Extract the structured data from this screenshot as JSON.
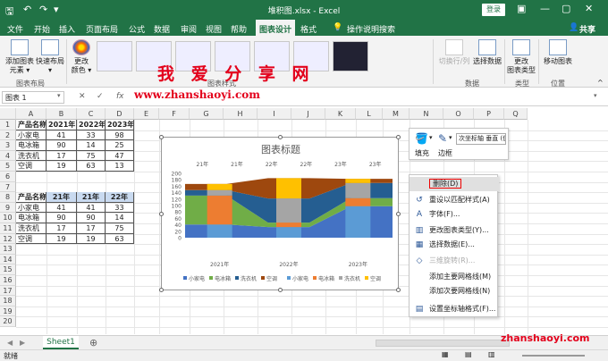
{
  "titlebar": {
    "title": "堆积图.xlsx - Excel",
    "login": "登录",
    "minimize": "—",
    "restore": "▢",
    "close": "✕"
  },
  "menu": {
    "tabs": [
      "文件",
      "开始",
      "插入",
      "页面布局",
      "公式",
      "数据",
      "审阅",
      "视图",
      "帮助",
      "图表设计",
      "格式"
    ],
    "active": "图表设计",
    "tellme": "操作说明搜索",
    "share": "共享"
  },
  "ribbon": {
    "add_element": "添加图表\n元素 ▾",
    "quick_layout": "快速布局\n▾",
    "change_colors": "更改\n颜色 ▾",
    "group_layout": "图表布局",
    "group_styles": "图表样式",
    "switch_row_col": "切换行/列",
    "select_data": "选择数据",
    "change_type": "更改\n图表类型",
    "move_chart": "移动图表",
    "group_data": "数据",
    "group_type": "类型",
    "group_location": "位置"
  },
  "watermark": {
    "line1": "我 爱 分 享 网",
    "line2": "www.zhanshaoyi.com",
    "footer": "zhanshaoyi.com"
  },
  "formula": {
    "namebox": "图表 1",
    "cancel": "✕",
    "enter": "✓",
    "fx": "fx"
  },
  "columns": [
    "A",
    "B",
    "C",
    "D",
    "E",
    "F",
    "G",
    "H",
    "I",
    "J",
    "K",
    "L",
    "M",
    "N",
    "O",
    "P",
    "Q"
  ],
  "rows": [
    "1",
    "2",
    "3",
    "4",
    "5",
    "6",
    "7",
    "8",
    "9",
    "10",
    "11",
    "12",
    "13",
    "14",
    "15",
    "16",
    "17",
    "18",
    "19",
    "20"
  ],
  "table1": {
    "header": [
      "产品名称",
      "2021年",
      "2022年",
      "2023年"
    ],
    "rows": [
      [
        "小家电",
        "41",
        "33",
        "98"
      ],
      [
        "电冰箱",
        "90",
        "14",
        "25"
      ],
      [
        "洗衣机",
        "17",
        "75",
        "47"
      ],
      [
        "空调",
        "19",
        "63",
        "13"
      ]
    ]
  },
  "table2": {
    "header": [
      "产品名称",
      "21年",
      "21年",
      "22年"
    ],
    "rows": [
      [
        "小家电",
        "41",
        "41",
        "33"
      ],
      [
        "电冰箱",
        "90",
        "90",
        "14"
      ],
      [
        "洗衣机",
        "17",
        "17",
        "75"
      ],
      [
        "空调",
        "19",
        "19",
        "63"
      ]
    ]
  },
  "chart_data": {
    "type": "area",
    "title": "图表标题",
    "top_axis_labels": [
      "21年",
      "21年",
      "22年",
      "22年",
      "23年",
      "23年"
    ],
    "categories": [
      "2021年",
      "2022年",
      "2023年"
    ],
    "ylim": [
      0,
      200
    ],
    "yticks": [
      "0",
      "20",
      "40",
      "60",
      "80",
      "100",
      "120",
      "140",
      "160",
      "180",
      "200"
    ],
    "bar_series": [
      {
        "name": "小家电",
        "values": [
          41,
          33,
          98
        ],
        "color": "#5b9bd5"
      },
      {
        "name": "电冰箱",
        "values": [
          90,
          14,
          25
        ],
        "color": "#ed7d31"
      },
      {
        "name": "洗衣机",
        "values": [
          17,
          75,
          47
        ],
        "color": "#a5a5a5"
      },
      {
        "name": "空调",
        "values": [
          19,
          63,
          13
        ],
        "color": "#ffc000"
      }
    ],
    "area_series": [
      {
        "name": "小家电",
        "values": [
          41,
          41,
          33,
          33,
          98,
          98
        ],
        "color": "#4472c4"
      },
      {
        "name": "电冰箱",
        "values": [
          90,
          90,
          14,
          14,
          25,
          25
        ],
        "color": "#70ad47"
      },
      {
        "name": "洗衣机",
        "values": [
          17,
          17,
          75,
          75,
          47,
          47
        ],
        "color": "#255e91"
      },
      {
        "name": "空调",
        "values": [
          19,
          19,
          63,
          63,
          13,
          13
        ],
        "color": "#9e480e"
      }
    ],
    "legend": [
      "小家电",
      "电冰箱",
      "洗衣机",
      "空调",
      "小家电",
      "电冰箱",
      "洗衣机",
      "空调"
    ],
    "legend_colors": [
      "#4472c4",
      "#70ad47",
      "#255e91",
      "#9e480e",
      "#5b9bd5",
      "#ed7d31",
      "#a5a5a5",
      "#ffc000"
    ],
    "legend_position": "bottom"
  },
  "minitoolbar": {
    "fill": "填充",
    "border": "边框",
    "dropdown": "次坐标轴 垂直 (值"
  },
  "context_menu": {
    "items": [
      {
        "label": "删除(D)",
        "icon": "",
        "disabled": false,
        "highlight": true
      },
      {
        "label": "重设以匹配样式(A)",
        "icon": "↺",
        "disabled": false
      },
      {
        "label": "字体(F)...",
        "icon": "A",
        "disabled": false
      },
      {
        "label": "更改图表类型(Y)...",
        "icon": "▥",
        "disabled": false
      },
      {
        "label": "选择数据(E)...",
        "icon": "▦",
        "disabled": false
      },
      {
        "label": "三维旋转(R)...",
        "icon": "◇",
        "disabled": true
      },
      {
        "label": "添加主要网格线(M)",
        "icon": "",
        "disabled": false
      },
      {
        "label": "添加次要网格线(N)",
        "icon": "",
        "disabled": false
      },
      {
        "label": "设置坐标轴格式(F)...",
        "icon": "▤",
        "disabled": false
      }
    ]
  },
  "sheetbar": {
    "tab": "Sheet1",
    "add": "⊕"
  },
  "status": {
    "ready": "就绪"
  }
}
